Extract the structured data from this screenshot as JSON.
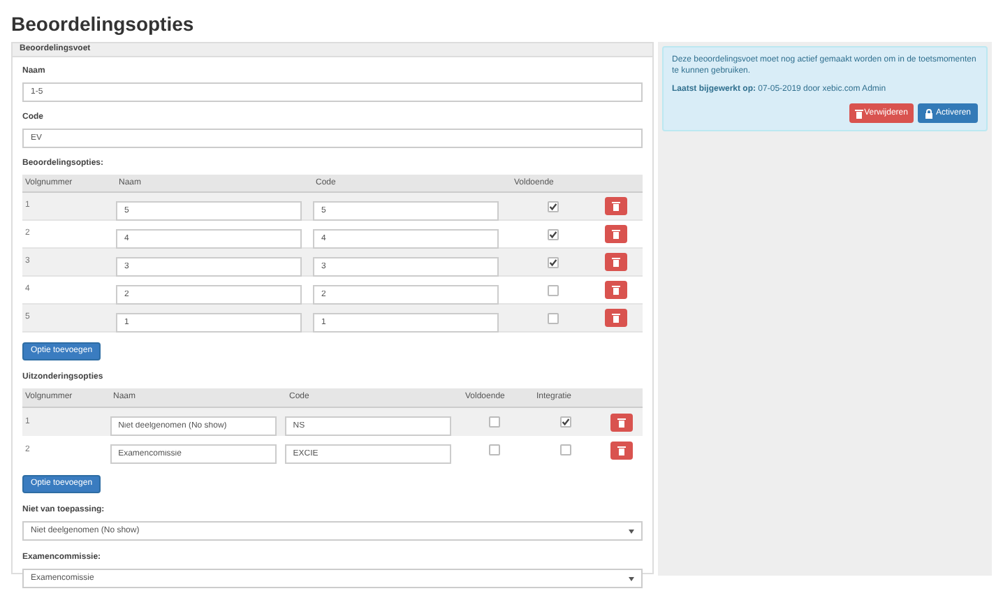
{
  "page_title": "Beoordelingsopties",
  "panel": {
    "title": "Beoordelingsvoet",
    "name_label": "Naam",
    "name_value": "1-5",
    "code_label": "Code",
    "code_value": "EV"
  },
  "options": {
    "label": "Beoordelingsopties:",
    "columns": [
      "Volgnummer",
      "Naam",
      "Code",
      "Voldoende"
    ],
    "rows": [
      {
        "number": "1",
        "name": "5",
        "code": "5",
        "sufficient": true
      },
      {
        "number": "2",
        "name": "4",
        "code": "4",
        "sufficient": true
      },
      {
        "number": "3",
        "name": "3",
        "code": "3",
        "sufficient": true
      },
      {
        "number": "4",
        "name": "2",
        "code": "2",
        "sufficient": false
      },
      {
        "number": "5",
        "name": "1",
        "code": "1",
        "sufficient": false
      }
    ],
    "add_button": "Optie toevoegen"
  },
  "exceptions": {
    "label": "Uitzonderingsopties",
    "columns": [
      "Volgnummer",
      "Naam",
      "Code",
      "Voldoende",
      "Integratie"
    ],
    "rows": [
      {
        "number": "1",
        "name": "Niet deelgenomen (No show)",
        "code": "NS",
        "sufficient": false,
        "integration": true
      },
      {
        "number": "2",
        "name": "Examencomissie",
        "code": "EXCIE",
        "sufficient": false,
        "integration": false
      }
    ],
    "add_button": "Optie toevoegen"
  },
  "not_applicable": {
    "label": "Niet van toepassing:",
    "value": "Niet deelgenomen (No show)"
  },
  "exam_committee": {
    "label": "Examencommissie:",
    "value": "Examencomissie"
  },
  "notice": {
    "message": "Deze beoordelingsvoet moet nog actief gemaakt worden om in de toetsmomenten te kunnen gebruiken.",
    "updated": "**Laatst bijgewerkt op:** 07-05-2019 door xebic.com Admin",
    "delete_button": "Verwijderen",
    "activate_button": "Activeren"
  }
}
